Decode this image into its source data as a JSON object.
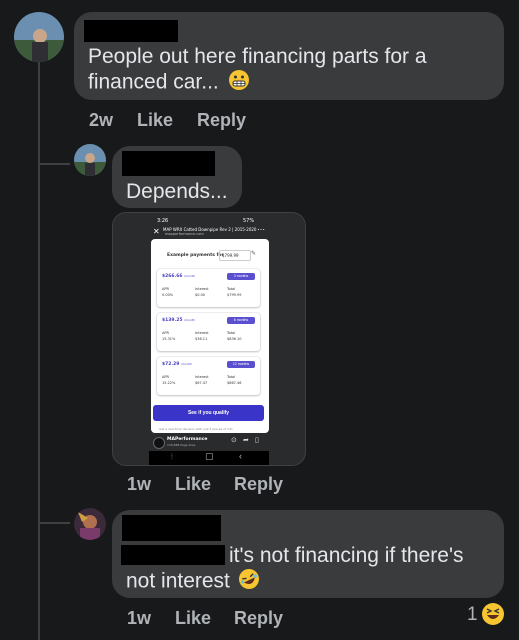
{
  "comments": [
    {
      "text_line1": "People out here financing parts for a",
      "text_line2": "financed car...",
      "emoji": "grimacing-face",
      "time": "2w",
      "like_label": "Like",
      "reply_label": "Reply"
    },
    {
      "text": "Depends...",
      "time": "1w",
      "like_label": "Like",
      "reply_label": "Reply",
      "attachment": {
        "status_time": "3:26",
        "status_right": "57%",
        "page_title": "MAP WRX Catted Downpipe Rev 2 | 2015-2020 Sub...",
        "page_url": "mapperformance.com",
        "example_label": "Example payments for",
        "price": "$799.99",
        "plans": [
          {
            "monthly": "$266.66",
            "per": "/month",
            "months": "3 months",
            "apr": "0.00%",
            "interest": "$0.00",
            "total": "$799.99"
          },
          {
            "monthly": "$139.25",
            "per": "/month",
            "months": "6 months",
            "apr": "15.31%",
            "interest": "$36.11",
            "total": "$836.10"
          },
          {
            "monthly": "$72.29",
            "per": "/month",
            "months": "12 months",
            "apr": "15.22%",
            "interest": "$67.47",
            "total": "$867.46"
          }
        ],
        "col_apr": "APR",
        "col_interest": "Interest",
        "col_total": "Total",
        "cta_label": "See if you qualify",
        "footnote": "Get a real-time decision with just 5 pieces of info",
        "page_name": "MAPerformance",
        "page_likes": "136,888 Page likes"
      }
    },
    {
      "text_line1": "it's not financing if there's",
      "text_line2": "not interest",
      "emoji": "rolling-on-floor-laughing",
      "time": "1w",
      "like_label": "Like",
      "reply_label": "Reply",
      "reaction_count": "1",
      "reaction_emoji": "laughing-face"
    }
  ],
  "colors": {
    "background": "#18191a",
    "bubble": "#3a3b3c",
    "text": "#e4e6eb",
    "secondary": "#b0b3b8",
    "cta": "#3a34c8"
  }
}
